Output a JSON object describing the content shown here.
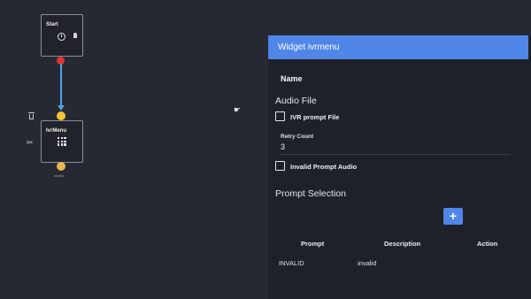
{
  "flow": {
    "start_node": {
      "title": "Start",
      "icons": [
        "clock-icon",
        "pin-icon"
      ]
    },
    "ivr_node": {
      "title": "IvrMenu",
      "icon": "grid-icon",
      "caption": "invalid"
    },
    "toolbar_icons": [
      "trash-icon",
      "scissors-icon"
    ],
    "colors": {
      "connector": "#4aa3e6",
      "start_port": "#e3342f",
      "ivr_port": "#f4c531"
    }
  },
  "panel": {
    "header": "Widget ivrmenu",
    "name_label": "Name",
    "audio_file": {
      "title": "Audio File",
      "ivr_prompt_label": "IVR prompt File",
      "ivr_prompt_checked": false,
      "retry_count_label": "Retry Count",
      "retry_count_value": "3",
      "invalid_prompt_label": "Invalid Prompt Audio",
      "invalid_prompt_checked": false
    },
    "prompt_selection": {
      "title": "Prompt Selection",
      "add_label": "+",
      "columns": [
        "Prompt",
        "Description",
        "Action"
      ],
      "rows": [
        {
          "prompt": "INVALID",
          "description": "invalid",
          "action": ""
        }
      ]
    },
    "colors": {
      "header_bg": "#4f86e8",
      "panel_bg": "#1e2129"
    }
  }
}
